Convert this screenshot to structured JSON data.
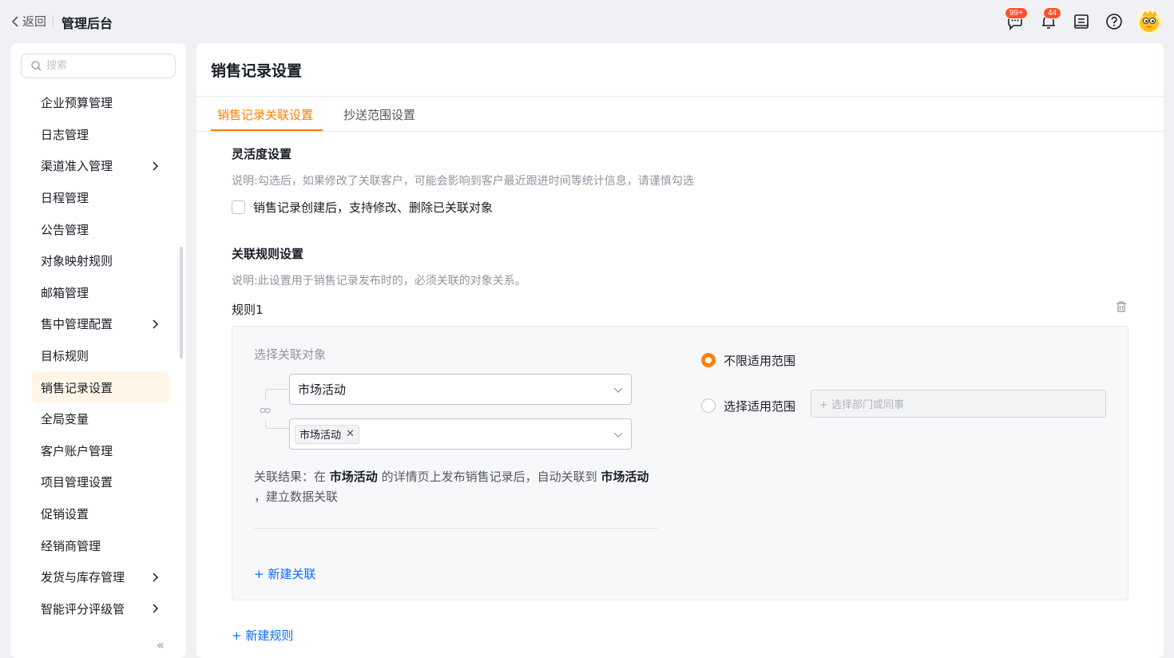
{
  "topbar": {
    "back_label": "返回",
    "app_title": "管理后台",
    "messages_badge": "99+",
    "notifications_badge": "44",
    "accent_color": "#ff8000",
    "badge_color": "#ff522a"
  },
  "sidebar": {
    "search_placeholder": "搜索",
    "items": [
      {
        "label": "企业预算管理",
        "has_children": false
      },
      {
        "label": "日志管理",
        "has_children": false
      },
      {
        "label": "渠道准入管理",
        "has_children": true
      },
      {
        "label": "日程管理",
        "has_children": false
      },
      {
        "label": "公告管理",
        "has_children": false
      },
      {
        "label": "对象映射规则",
        "has_children": false
      },
      {
        "label": "邮箱管理",
        "has_children": false
      },
      {
        "label": "售中管理配置",
        "has_children": true
      },
      {
        "label": "目标规则",
        "has_children": false
      },
      {
        "label": "销售记录设置",
        "has_children": false,
        "active": true
      },
      {
        "label": "全局变量",
        "has_children": false
      },
      {
        "label": "客户账户管理",
        "has_children": false
      },
      {
        "label": "项目管理设置",
        "has_children": false
      },
      {
        "label": "促销设置",
        "has_children": false
      },
      {
        "label": "经销商管理",
        "has_children": false
      },
      {
        "label": "发货与库存管理",
        "has_children": true
      },
      {
        "label": "智能评分评级管",
        "has_children": true
      }
    ],
    "collapse_glyph": "«"
  },
  "main": {
    "title": "销售记录设置",
    "tabs": [
      {
        "label": "销售记录关联设置",
        "active": true
      },
      {
        "label": "抄送范围设置",
        "active": false
      }
    ],
    "flex": {
      "title": "灵活度设置",
      "desc": "说明:勾选后，如果修改了关联客户，可能会影响到客户最近跟进时间等统计信息，请谨慎勾选",
      "checkbox_label": "销售记录创建后，支持修改、删除已关联对象",
      "checked": false
    },
    "rules": {
      "title": "关联规则设置",
      "desc": "说明:此设置用于销售记录发布时的，必须关联的对象关系。",
      "rule_label": "规则1",
      "select_label": "选择关联对象",
      "primary_object": "市场活动",
      "linked_tag": "市场活动",
      "result_prefix": "关联结果：在 ",
      "result_obj1": "市场活动",
      "result_mid": " 的详情页上发布销售记录后，自动关联到 ",
      "result_obj2": "市场活动",
      "result_suffix": "，建立数据关联",
      "add_link": "+ 新建关联",
      "scope_unlimited": "不限适用范围",
      "scope_select": "选择适用范围",
      "scope_placeholder": "+ 选择部门或同事",
      "selected_scope": "不限适用范围"
    },
    "add_rule": "+ 新建规则"
  }
}
